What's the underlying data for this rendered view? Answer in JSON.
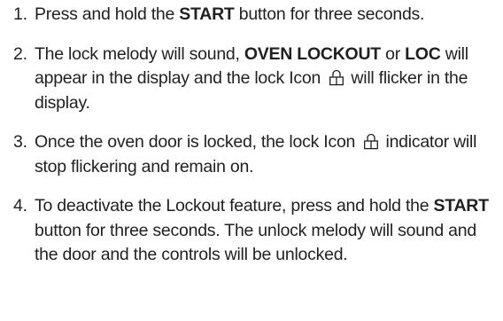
{
  "steps": [
    {
      "number": "1.",
      "parts": {
        "t1": "Press and hold the ",
        "b1": "START",
        "t2": " button for three seconds."
      }
    },
    {
      "number": "2.",
      "parts": {
        "t1": "The lock melody will sound, ",
        "b1": "OVEN LOCKOUT",
        "t2": " or ",
        "b2": "LOC",
        "t3": " will appear in the display and the lock Icon ",
        "t4": " will flicker in the display."
      }
    },
    {
      "number": "3.",
      "parts": {
        "t1": "Once the oven door is locked, the lock Icon ",
        "t2": " indicator will stop flickering and remain on."
      }
    },
    {
      "number": "4.",
      "parts": {
        "t1": "To deactivate the Lockout feature, press and hold the ",
        "b1": "START",
        "t2": " button for three seconds. The unlock melody will sound and the door and the controls will be unlocked."
      }
    }
  ],
  "icons": {
    "lock": "lock-icon"
  },
  "colors": {
    "text": "#231f20"
  }
}
